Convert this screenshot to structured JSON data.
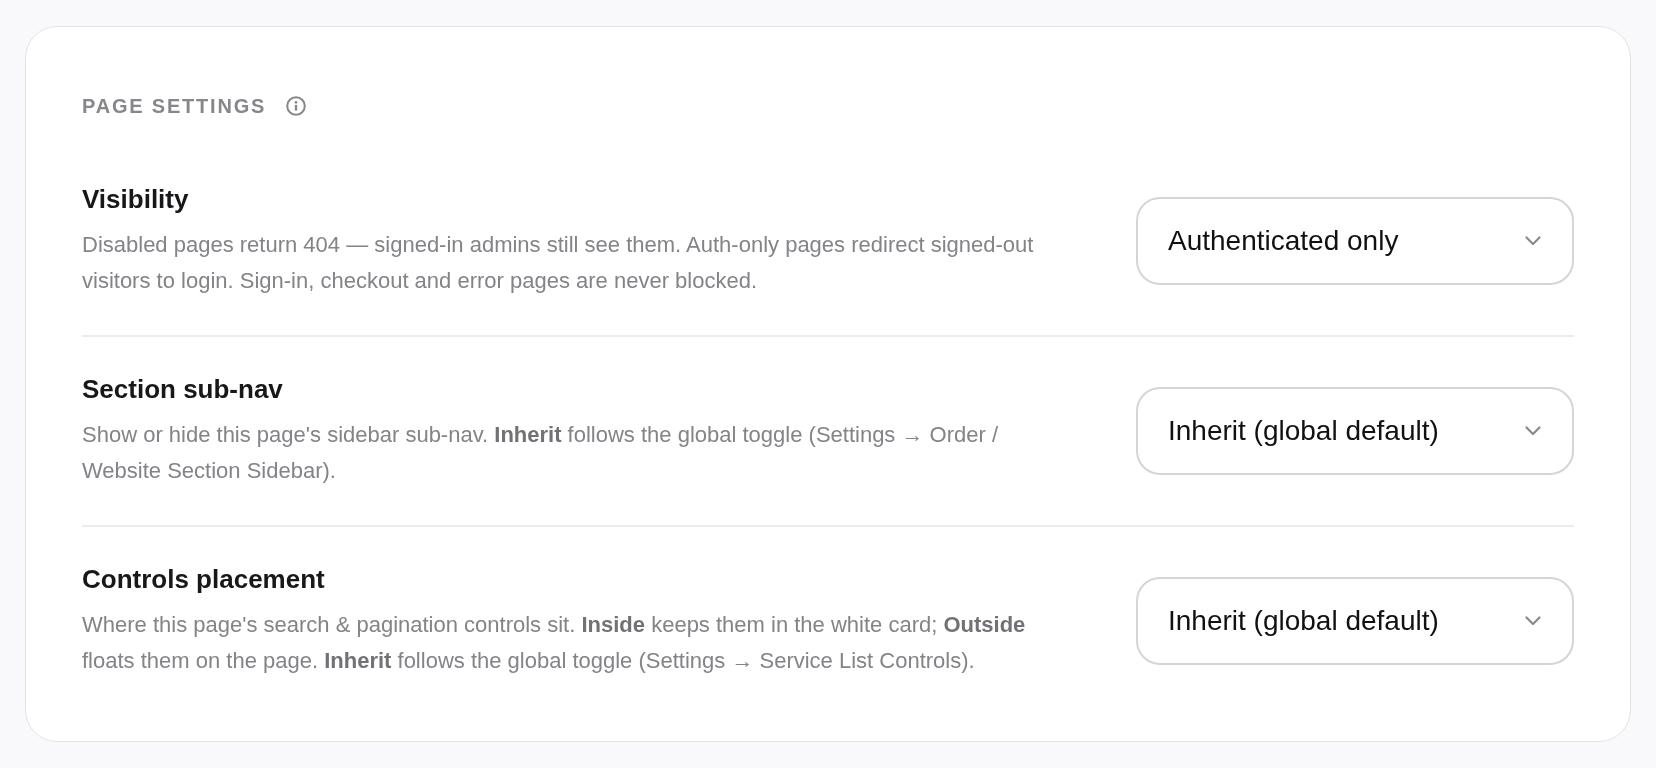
{
  "section": {
    "title": "PAGE SETTINGS"
  },
  "settings": [
    {
      "label": "Visibility",
      "description": "Disabled pages return 404 — signed-in admins still see them. Auth-only pages redirect signed-out visitors to login. Sign-in, checkout and error pages are never blocked.",
      "value": "Authenticated only"
    },
    {
      "label": "Section sub-nav",
      "description": "Show or hide this page's sidebar sub-nav. **Inherit** follows the global toggle (Settings → Order / Website Section Sidebar).",
      "value": "Inherit (global default)"
    },
    {
      "label": "Controls placement",
      "description": "Where this page's search & pagination controls sit. **Inside** keeps them in the white card; **Outside** floats them on the page. **Inherit** follows the global toggle (Settings → Service List Controls).",
      "value": "Inherit (global default)"
    }
  ]
}
